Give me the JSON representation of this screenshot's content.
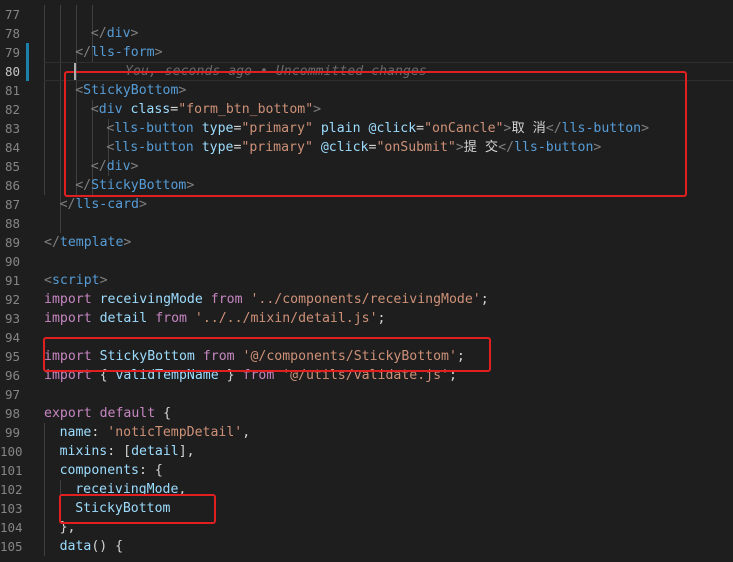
{
  "editor": {
    "line_numbers": [
      "77",
      "78",
      "79",
      "80",
      "81",
      "82",
      "83",
      "84",
      "85",
      "86",
      "87",
      "88",
      "89",
      "90",
      "91",
      "92",
      "93",
      "94",
      "95",
      "96",
      "97",
      "98",
      "99",
      "100",
      "101",
      "102",
      "103",
      "104",
      "105"
    ],
    "blame_text": "You, seconds ago • Uncommitted changes",
    "lines": [
      [],
      [
        [
          "t-bracket",
          "</"
        ],
        [
          "t-tag",
          "div"
        ],
        [
          "t-bracket",
          ">"
        ]
      ],
      [
        [
          "t-bracket",
          "</"
        ],
        [
          "t-tag",
          "lls-form"
        ],
        [
          "t-bracket",
          ">"
        ]
      ],
      [],
      [
        [
          "t-bracket",
          "<"
        ],
        [
          "t-tag",
          "StickyBottom"
        ],
        [
          "t-bracket",
          ">"
        ]
      ],
      [
        [
          "t-bracket",
          "<"
        ],
        [
          "t-tag",
          "div"
        ],
        [
          "t-text",
          " "
        ],
        [
          "t-attr",
          "class"
        ],
        [
          "t-eq",
          "="
        ],
        [
          "t-str",
          "\"form_btn_bottom\""
        ],
        [
          "t-bracket",
          ">"
        ]
      ],
      [
        [
          "t-bracket",
          "<"
        ],
        [
          "t-tag",
          "lls-button"
        ],
        [
          "t-text",
          " "
        ],
        [
          "t-attr",
          "type"
        ],
        [
          "t-eq",
          "="
        ],
        [
          "t-str",
          "\"primary\""
        ],
        [
          "t-text",
          " "
        ],
        [
          "t-attr",
          "plain"
        ],
        [
          "t-text",
          " "
        ],
        [
          "t-attr",
          "@click"
        ],
        [
          "t-eq",
          "="
        ],
        [
          "t-str",
          "\"onCancle\""
        ],
        [
          "t-bracket",
          ">"
        ],
        [
          "t-text",
          "取 消"
        ],
        [
          "t-bracket",
          "</"
        ],
        [
          "t-tag",
          "lls-button"
        ],
        [
          "t-bracket",
          ">"
        ]
      ],
      [
        [
          "t-bracket",
          "<"
        ],
        [
          "t-tag",
          "lls-button"
        ],
        [
          "t-text",
          " "
        ],
        [
          "t-attr",
          "type"
        ],
        [
          "t-eq",
          "="
        ],
        [
          "t-str",
          "\"primary\""
        ],
        [
          "t-text",
          " "
        ],
        [
          "t-attr",
          "@click"
        ],
        [
          "t-eq",
          "="
        ],
        [
          "t-str",
          "\"onSubmit\""
        ],
        [
          "t-bracket",
          ">"
        ],
        [
          "t-text",
          "提 交"
        ],
        [
          "t-bracket",
          "</"
        ],
        [
          "t-tag",
          "lls-button"
        ],
        [
          "t-bracket",
          ">"
        ]
      ],
      [
        [
          "t-bracket",
          "</"
        ],
        [
          "t-tag",
          "div"
        ],
        [
          "t-bracket",
          ">"
        ]
      ],
      [
        [
          "t-bracket",
          "</"
        ],
        [
          "t-tag",
          "StickyBottom"
        ],
        [
          "t-bracket",
          ">"
        ]
      ],
      [
        [
          "t-bracket",
          "</"
        ],
        [
          "t-tag",
          "lls-card"
        ],
        [
          "t-bracket",
          ">"
        ]
      ],
      [],
      [
        [
          "t-bracket",
          "</"
        ],
        [
          "t-tag",
          "template"
        ],
        [
          "t-bracket",
          ">"
        ]
      ],
      [],
      [
        [
          "t-bracket",
          "<"
        ],
        [
          "t-tag",
          "script"
        ],
        [
          "t-bracket",
          ">"
        ]
      ],
      [
        [
          "t-kw",
          "import"
        ],
        [
          "t-text",
          " "
        ],
        [
          "t-id",
          "receivingMode"
        ],
        [
          "t-text",
          " "
        ],
        [
          "t-kw",
          "from"
        ],
        [
          "t-text",
          " "
        ],
        [
          "t-str",
          "'../components/receivingMode'"
        ],
        [
          "t-punct",
          ";"
        ]
      ],
      [
        [
          "t-kw",
          "import"
        ],
        [
          "t-text",
          " "
        ],
        [
          "t-id",
          "detail"
        ],
        [
          "t-text",
          " "
        ],
        [
          "t-kw",
          "from"
        ],
        [
          "t-text",
          " "
        ],
        [
          "t-str",
          "'../../mixin/detail.js'"
        ],
        [
          "t-punct",
          ";"
        ]
      ],
      [],
      [
        [
          "t-kw",
          "import"
        ],
        [
          "t-text",
          " "
        ],
        [
          "t-id",
          "StickyBottom"
        ],
        [
          "t-text",
          " "
        ],
        [
          "t-kw",
          "from"
        ],
        [
          "t-text",
          " "
        ],
        [
          "t-str",
          "'@/components/StickyBottom'"
        ],
        [
          "t-punct",
          ";"
        ]
      ],
      [
        [
          "t-kw",
          "import"
        ],
        [
          "t-punct",
          " { "
        ],
        [
          "t-id",
          "validTempName"
        ],
        [
          "t-punct",
          " } "
        ],
        [
          "t-kw",
          "from"
        ],
        [
          "t-text",
          " "
        ],
        [
          "t-str",
          "'@/utils/validate.js'"
        ],
        [
          "t-punct",
          ";"
        ]
      ],
      [],
      [
        [
          "t-kw",
          "export"
        ],
        [
          "t-text",
          " "
        ],
        [
          "t-kw",
          "default"
        ],
        [
          "t-punct",
          " {"
        ]
      ],
      [
        [
          "t-id",
          "name"
        ],
        [
          "t-punct",
          ": "
        ],
        [
          "t-str",
          "'noticTempDetail'"
        ],
        [
          "t-punct",
          ","
        ]
      ],
      [
        [
          "t-id",
          "mixins"
        ],
        [
          "t-punct",
          ": ["
        ],
        [
          "t-id",
          "detail"
        ],
        [
          "t-punct",
          "],"
        ]
      ],
      [
        [
          "t-id",
          "components"
        ],
        [
          "t-punct",
          ": {"
        ]
      ],
      [
        [
          "t-id",
          "receivingMode"
        ],
        [
          "t-punct",
          ","
        ]
      ],
      [
        [
          "t-id",
          "StickyBottom"
        ]
      ],
      [
        [
          "t-punct",
          "},"
        ]
      ],
      [
        [
          "t-id",
          "data"
        ],
        [
          "t-punct",
          "() {"
        ]
      ]
    ]
  }
}
